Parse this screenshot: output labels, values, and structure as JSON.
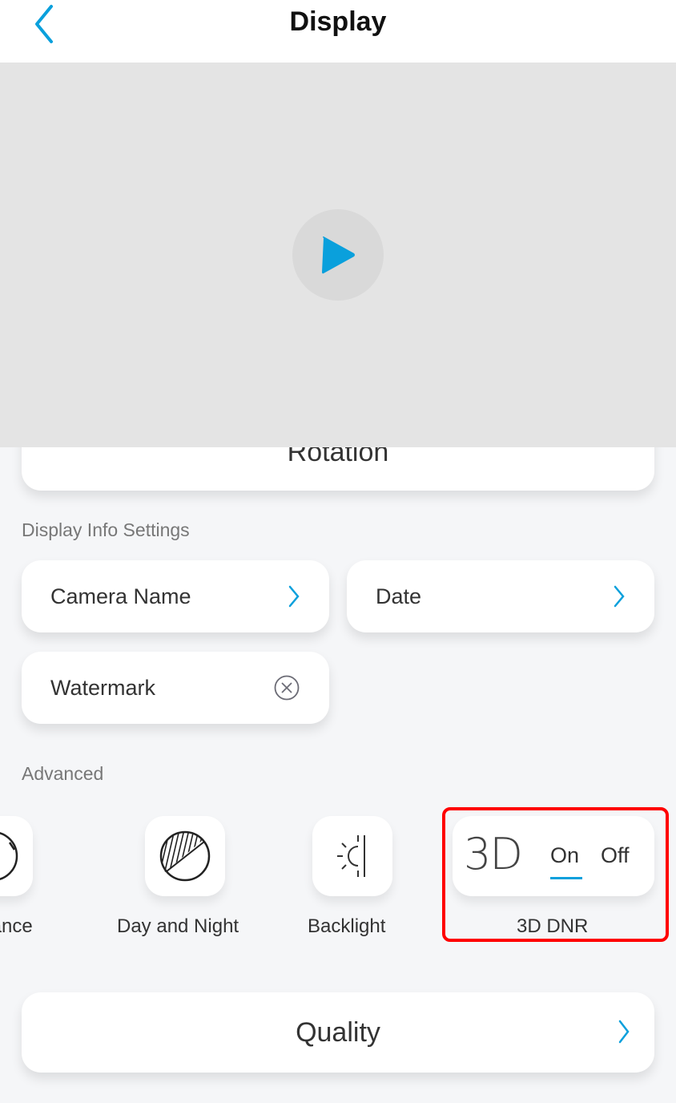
{
  "header": {
    "title": "Display",
    "back_icon": "chevron-left-icon"
  },
  "video_preview": {
    "play_icon": "play-icon"
  },
  "rotation": {
    "label": "Rotation"
  },
  "display_info": {
    "section_label": "Display Info Settings",
    "items": [
      {
        "label": "Camera Name",
        "icon": "chevron-right-icon"
      },
      {
        "label": "Date",
        "icon": "chevron-right-icon"
      },
      {
        "label": "Watermark",
        "icon": "close-circle-icon"
      }
    ]
  },
  "advanced": {
    "section_label": "Advanced",
    "tiles": [
      {
        "label": "alance",
        "icon": "white-balance-icon"
      },
      {
        "label": "Day and Night",
        "icon": "day-night-icon"
      },
      {
        "label": "Backlight",
        "icon": "backlight-icon"
      }
    ],
    "dnr": {
      "glyph": "3D",
      "on_label": "On",
      "off_label": "Off",
      "selected": "On",
      "label": "3D DNR"
    }
  },
  "quality": {
    "label": "Quality",
    "icon": "chevron-right-icon"
  },
  "colors": {
    "accent": "#0aa0dc",
    "highlight": "#ff0000",
    "background": "#f5f6f8",
    "video_bg": "#e4e4e4"
  }
}
